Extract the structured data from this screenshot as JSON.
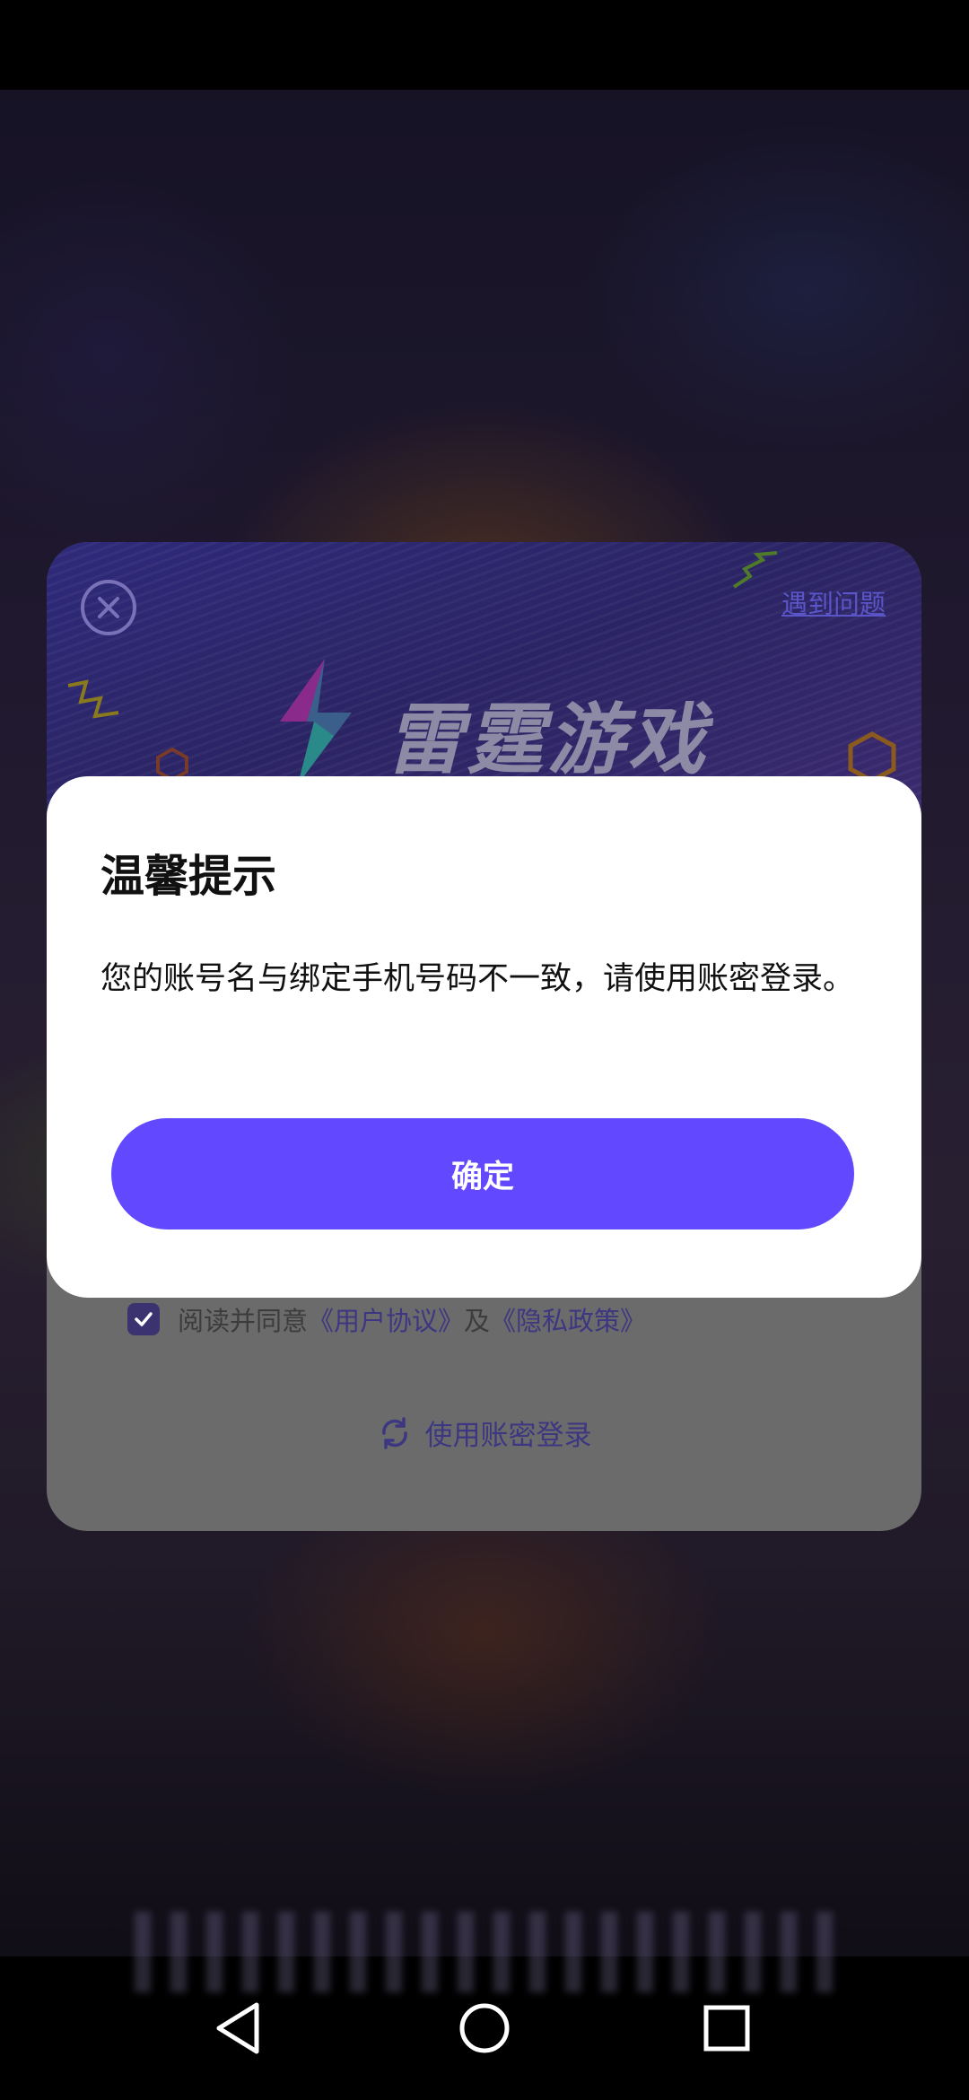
{
  "login_card": {
    "help_link": "遇到问题",
    "logo_text": "雷霆游戏",
    "agreement": {
      "prefix": "阅读并同意",
      "user_agreement": "《用户协议》",
      "and": "及",
      "privacy_policy": "《隐私政策》",
      "checked": true
    },
    "switch_login_label": "使用账密登录"
  },
  "dialog": {
    "title": "温馨提示",
    "message": "您的账号名与绑定手机号码不一致，请使用账密登录。",
    "confirm_label": "确定"
  },
  "colors": {
    "accent": "#6249ff",
    "link": "#3d3680"
  },
  "icons": {
    "close": "close-circle-icon",
    "switch": "refresh-icon",
    "checkbox": "checkbox-checked-icon",
    "nav_back": "triangle-back-icon",
    "nav_home": "circle-home-icon",
    "nav_recent": "square-recent-icon"
  }
}
